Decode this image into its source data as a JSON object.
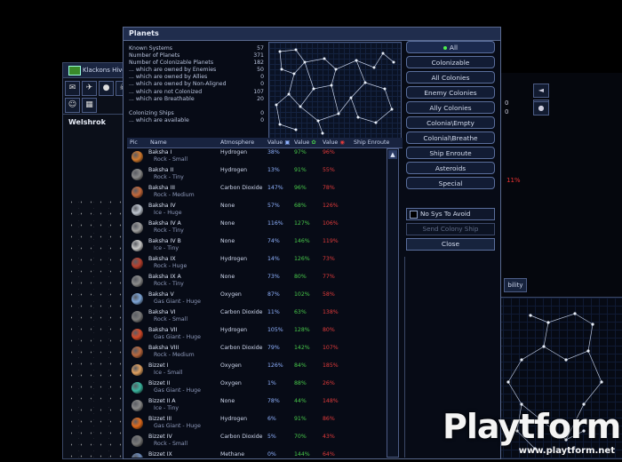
{
  "background_window_left": {
    "title": "Klackons Hive",
    "system_name": "Welshrok",
    "toolbar_icons": [
      "paper-icon",
      "ship-icon",
      "planet-icon",
      "skull-icon",
      "ghost-icon",
      "chart-icon"
    ]
  },
  "background_window_right": {
    "values": [
      "0",
      "0"
    ],
    "ship_label": "11%",
    "ability_label": "bility"
  },
  "window": {
    "title": "Planets",
    "stats": [
      {
        "label": "Known Systems",
        "value": "57"
      },
      {
        "label": "Number of Planets",
        "value": "371"
      },
      {
        "label": "Number of Colonizable Planets",
        "value": "182"
      },
      {
        "label": "... which are owned by Enemies",
        "value": "50"
      },
      {
        "label": "... which are owned by Allies",
        "value": "0"
      },
      {
        "label": "... which are owned by Non-Aligned",
        "value": "0"
      },
      {
        "label": "... which are not Colonized",
        "value": "107"
      },
      {
        "label": "... which are Breathable",
        "value": "20"
      },
      {
        "label": "",
        "value": ""
      },
      {
        "label": "Colonizing Ships",
        "value": "0"
      },
      {
        "label": "... which are available",
        "value": "0"
      }
    ],
    "filter_buttons": [
      "All",
      "Colonizable",
      "All Colonies",
      "Enemy Colonies",
      "Ally Colonies",
      "Colonia\\Empty",
      "Colonial\\Breathe",
      "Ship Enroute",
      "Asteroids",
      "Special"
    ],
    "no_sys_label": "No Sys To Avoid",
    "send_label": "Send Colony Ship",
    "close_label": "Close",
    "columns": [
      "Pic",
      "Name",
      "Atmosphere",
      "Value",
      "Value",
      "Value",
      "Ship Enroute"
    ],
    "planets": [
      {
        "name": "Baksha I",
        "sub": "Rock - Small",
        "atm": "Hydrogen",
        "v1": "38%",
        "v2": "97%",
        "v3": "96%",
        "color": "#d27a2e"
      },
      {
        "name": "Baksha II",
        "sub": "Rock - Tiny",
        "atm": "Hydrogen",
        "v1": "13%",
        "v2": "91%",
        "v3": "55%",
        "color": "#8a8a8a"
      },
      {
        "name": "Baksha III",
        "sub": "Rock - Medium",
        "atm": "Carbon Dioxide",
        "v1": "147%",
        "v2": "96%",
        "v3": "78%",
        "color": "#c4683a"
      },
      {
        "name": "Baksha IV",
        "sub": "Ice - Huge",
        "atm": "None",
        "v1": "57%",
        "v2": "68%",
        "v3": "126%",
        "color": "#bfc6d0"
      },
      {
        "name": "Baksha IV A",
        "sub": "Rock - Tiny",
        "atm": "None",
        "v1": "116%",
        "v2": "127%",
        "v3": "106%",
        "color": "#a0a0a0"
      },
      {
        "name": "Baksha IV B",
        "sub": "Ice - Tiny",
        "atm": "None",
        "v1": "74%",
        "v2": "146%",
        "v3": "119%",
        "color": "#c9c9c9"
      },
      {
        "name": "Baksha IX",
        "sub": "Rock - Huge",
        "atm": "Hydrogen",
        "v1": "14%",
        "v2": "126%",
        "v3": "73%",
        "color": "#b8402e"
      },
      {
        "name": "Baksha IX A",
        "sub": "Rock - Tiny",
        "atm": "None",
        "v1": "73%",
        "v2": "80%",
        "v3": "77%",
        "color": "#8c8c8c"
      },
      {
        "name": "Baksha V",
        "sub": "Gas Giant - Huge",
        "atm": "Oxygen",
        "v1": "87%",
        "v2": "102%",
        "v3": "58%",
        "color": "#7ea6d8"
      },
      {
        "name": "Baksha VI",
        "sub": "Rock - Small",
        "atm": "Carbon Dioxide",
        "v1": "11%",
        "v2": "63%",
        "v3": "138%",
        "color": "#7c7c7c"
      },
      {
        "name": "Baksha VII",
        "sub": "Gas Giant - Huge",
        "atm": "Hydrogen",
        "v1": "105%",
        "v2": "128%",
        "v3": "80%",
        "color": "#d24a2a"
      },
      {
        "name": "Baksha VIII",
        "sub": "Rock - Medium",
        "atm": "Carbon Dioxide",
        "v1": "79%",
        "v2": "142%",
        "v3": "107%",
        "color": "#b9683e"
      },
      {
        "name": "Bizzet I",
        "sub": "Ice - Small",
        "atm": "Oxygen",
        "v1": "126%",
        "v2": "84%",
        "v3": "185%",
        "color": "#e0a060"
      },
      {
        "name": "Bizzet II",
        "sub": "Gas Giant - Huge",
        "atm": "Oxygen",
        "v1": "1%",
        "v2": "88%",
        "v3": "26%",
        "color": "#3bb6a0"
      },
      {
        "name": "Bizzet II A",
        "sub": "Ice - Tiny",
        "atm": "None",
        "v1": "78%",
        "v2": "44%",
        "v3": "148%",
        "color": "#8a8a8a"
      },
      {
        "name": "Bizzet III",
        "sub": "Gas Giant - Huge",
        "atm": "Hydrogen",
        "v1": "6%",
        "v2": "91%",
        "v3": "86%",
        "color": "#e06a1c"
      },
      {
        "name": "Bizzet IV",
        "sub": "Rock - Small",
        "atm": "Carbon Dioxide",
        "v1": "5%",
        "v2": "70%",
        "v3": "43%",
        "color": "#7a7a7a"
      },
      {
        "name": "Bizzet IX",
        "sub": "Gas Giant - Huge",
        "atm": "Methane",
        "v1": "0%",
        "v2": "144%",
        "v3": "64%",
        "color": "#6c8ab8"
      }
    ]
  },
  "watermark": {
    "logo": "Playtform",
    "url": "www.playtform.net"
  },
  "colors": {
    "value1": "#8fb2ff",
    "value2": "#47c84a",
    "value3": "#e23b3b",
    "border": "#59698f"
  }
}
